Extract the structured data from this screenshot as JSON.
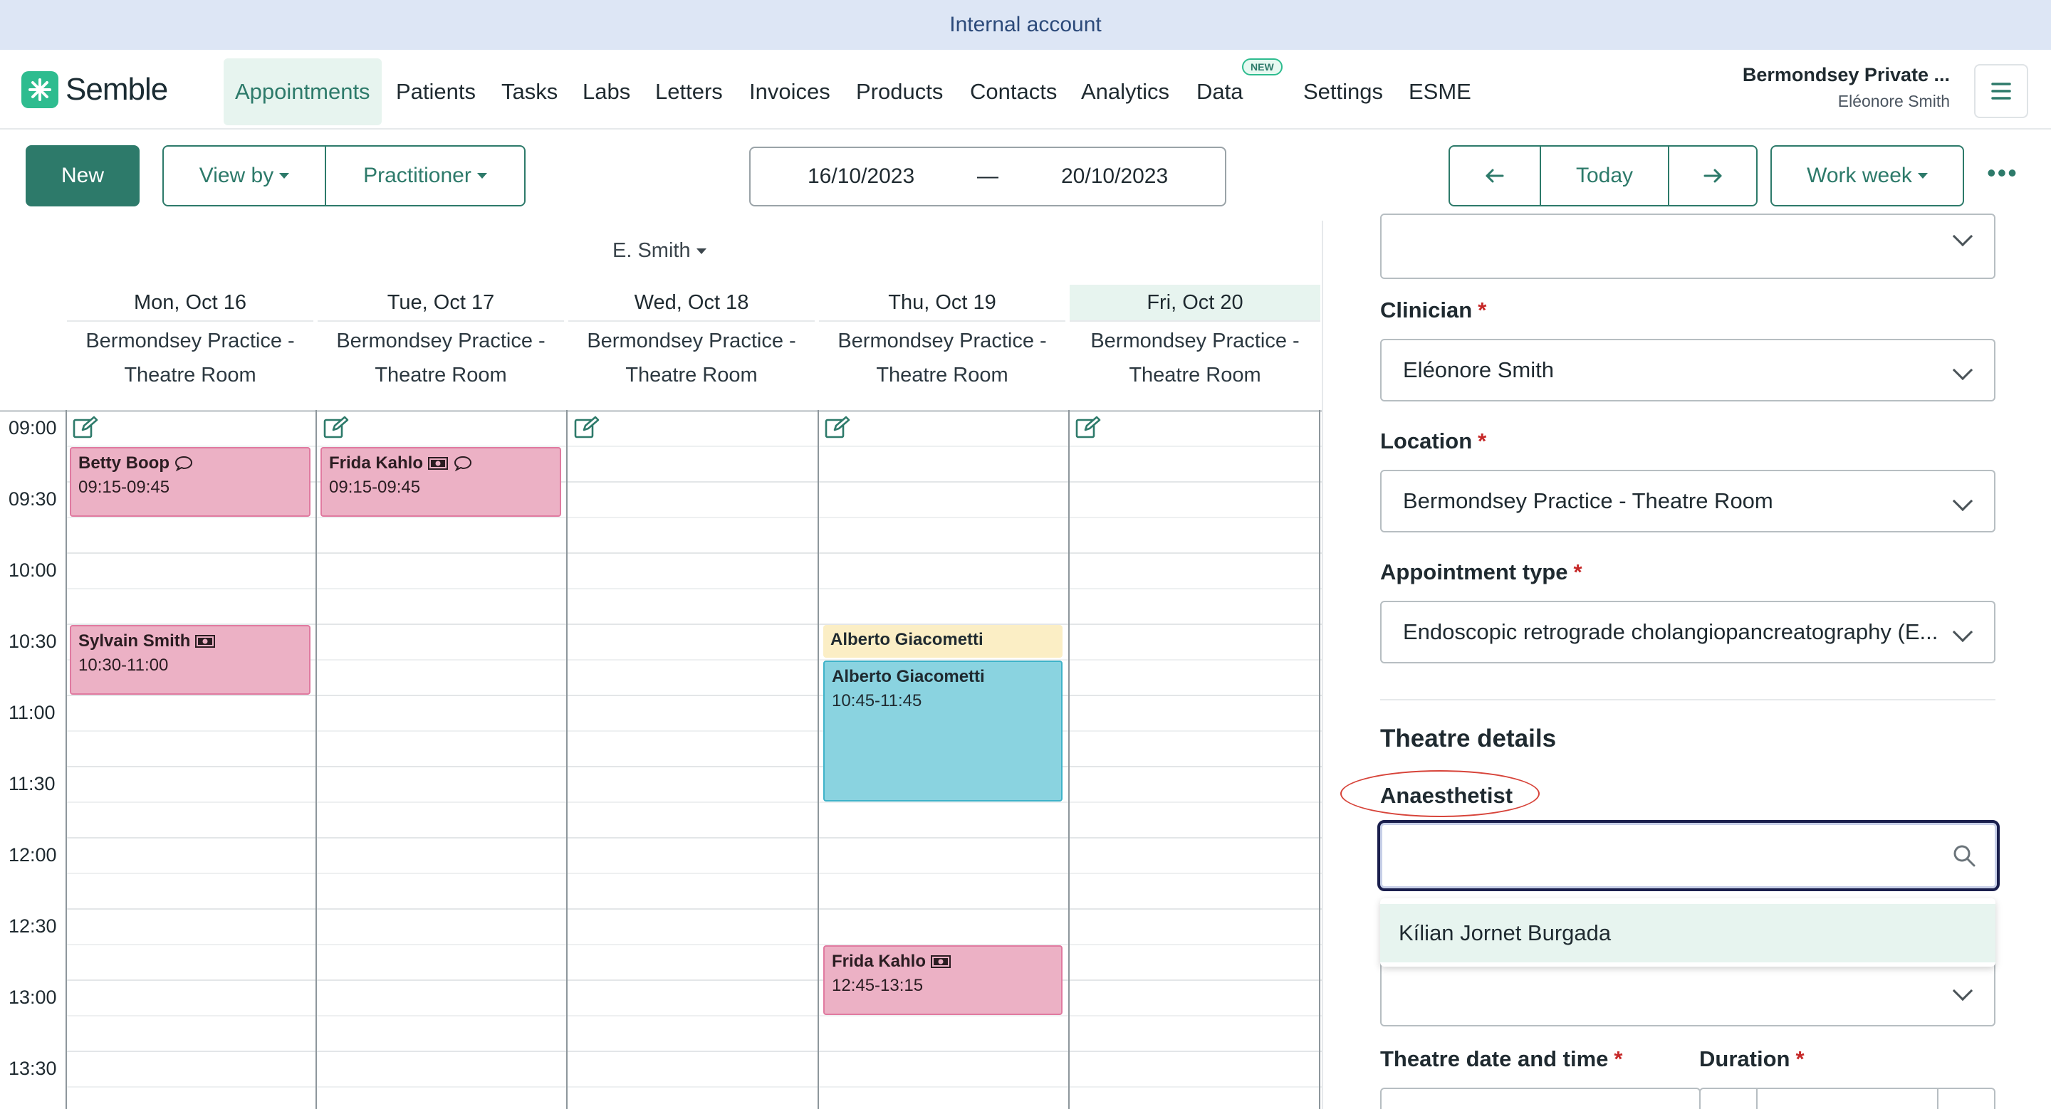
{
  "banner": {
    "text": "Internal account"
  },
  "nav": {
    "brand": "Semble",
    "items": [
      {
        "label": "Appointments",
        "active": true
      },
      {
        "label": "Patients"
      },
      {
        "label": "Tasks"
      },
      {
        "label": "Labs"
      },
      {
        "label": "Letters"
      },
      {
        "label": "Invoices"
      },
      {
        "label": "Products"
      },
      {
        "label": "Contacts"
      },
      {
        "label": "Analytics"
      },
      {
        "label": "Data",
        "badge": "NEW"
      },
      {
        "label": "Settings"
      },
      {
        "label": "ESME"
      }
    ],
    "account_name": "Bermondsey Private ...",
    "account_user": "Eléonore Smith",
    "menu_icon": "hamburger-icon"
  },
  "toolbar": {
    "new_label": "New",
    "view_by_label": "View by",
    "practitioner_label": "Practitioner",
    "date_from": "16/10/2023",
    "date_separator": "—",
    "date_to": "20/10/2023",
    "prev_icon": "arrow-left-icon",
    "today_label": "Today",
    "next_icon": "arrow-right-icon",
    "work_week_label": "Work week",
    "more_icon": "more-horizontal-icon",
    "more_label": "•••"
  },
  "calendar": {
    "practitioner": "E. Smith",
    "days": [
      {
        "date": "Mon, Oct 16",
        "location_line1": "Bermondsey Practice -",
        "location_line2": "Theatre Room"
      },
      {
        "date": "Tue, Oct 17",
        "location_line1": "Bermondsey Practice -",
        "location_line2": "Theatre Room"
      },
      {
        "date": "Wed, Oct 18",
        "location_line1": "Bermondsey Practice -",
        "location_line2": "Theatre Room"
      },
      {
        "date": "Thu, Oct 19",
        "location_line1": "Bermondsey Practice -",
        "location_line2": "Theatre Room"
      },
      {
        "date": "Fri, Oct 20",
        "location_line1": "Bermondsey Practice -",
        "location_line2": "Theatre Room",
        "today": true
      }
    ],
    "times": [
      "09:00",
      "09:30",
      "10:00",
      "10:30",
      "11:00",
      "11:30",
      "12:00",
      "12:30",
      "13:00",
      "13:30"
    ],
    "appointments": [
      {
        "patient": "Betty Boop",
        "time": "09:15-09:45",
        "icons": [
          "comment-icon"
        ],
        "color": "#ecb1c5"
      },
      {
        "patient": "Frida Kahlo",
        "time": "09:15-09:45",
        "icons": [
          "payment-icon",
          "comment-icon"
        ],
        "color": "#ecb1c5"
      },
      {
        "patient": "Sylvain Smith",
        "time": "10:30-11:00",
        "icons": [
          "payment-icon"
        ],
        "color": "#ecb1c5"
      },
      {
        "patient": "Alberto Giacometti",
        "time": "",
        "icons": [],
        "color": "#fbeec5"
      },
      {
        "patient": "Alberto Giacometti",
        "time": "10:45-11:45",
        "icons": [],
        "color": "#8ad3e0"
      },
      {
        "patient": "Frida Kahlo",
        "time": "12:45-13:15",
        "icons": [
          "payment-icon"
        ],
        "color": "#ecb1c5"
      }
    ]
  },
  "panel": {
    "clinician_label": "Clinician",
    "clinician_value": "Eléonore Smith",
    "location_label": "Location",
    "location_value": "Bermondsey Practice - Theatre Room",
    "appointment_type_label": "Appointment type",
    "appointment_type_value": "Endoscopic retrograde cholangiopancreatography (E...",
    "required_mark": "*",
    "section_title": "Theatre details",
    "anaesthetist_label": "Anaesthetist",
    "anaesthetist_value": "",
    "dropdown_option": "Kílian Jornet Burgada",
    "theatre_datetime_label": "Theatre date and time",
    "duration_label": "Duration"
  },
  "colors": {
    "brand": "#2d7a6a",
    "accent": "#2ebc8f",
    "banner": "#dde6f5",
    "today_bg": "#e7f4ef",
    "required": "#c62828",
    "annotation": "#d7443a"
  }
}
